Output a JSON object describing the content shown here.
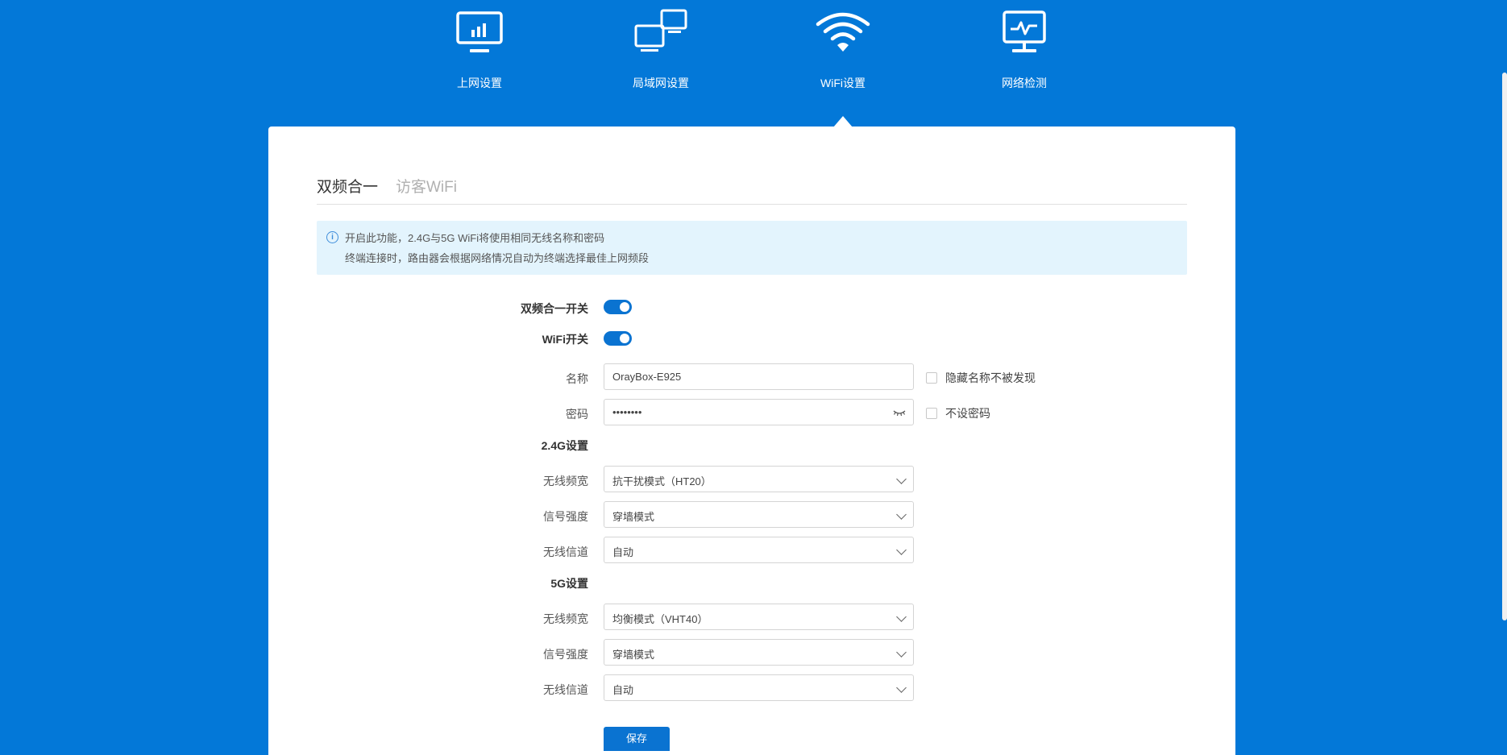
{
  "nav": {
    "items": [
      {
        "label": "上网设置",
        "icon": "monitor-chart-icon"
      },
      {
        "label": "局域网设置",
        "icon": "lan-monitors-icon"
      },
      {
        "label": "WiFi设置",
        "icon": "wifi-icon"
      },
      {
        "label": "网络检测",
        "icon": "network-check-icon"
      }
    ],
    "active_index": 2
  },
  "tabs": {
    "active": "双频合一",
    "guest": "访客WiFi"
  },
  "notice": {
    "line1": "开启此功能，2.4G与5G WiFi将使用相同无线名称和密码",
    "line2": "终端连接时，路由器会根据网络情况自动为终端选择最佳上网频段"
  },
  "form": {
    "dual_band_label": "双频合一开关",
    "dual_band_on": true,
    "wifi_label": "WiFi开关",
    "wifi_on": true,
    "name_label": "名称",
    "name_value": "OrayBox-E925",
    "hide_name_label": "隐藏名称不被发现",
    "password_label": "密码",
    "password_value": "••••••••",
    "no_password_label": "不设密码",
    "g24_title": "2.4G设置",
    "g24": {
      "bandwidth_label": "无线频宽",
      "bandwidth_value": "抗干扰模式（HT20）",
      "signal_label": "信号强度",
      "signal_value": "穿墙模式",
      "channel_label": "无线信道",
      "channel_value": "自动"
    },
    "g5_title": "5G设置",
    "g5": {
      "bandwidth_label": "无线频宽",
      "bandwidth_value": "均衡模式（VHT40）",
      "signal_label": "信号强度",
      "signal_value": "穿墙模式",
      "channel_label": "无线信道",
      "channel_value": "自动"
    },
    "save_label": "保存"
  },
  "colors": {
    "brand_blue": "#0378d8",
    "accent": "#0a73d1",
    "notice_bg": "#e3f4fd"
  }
}
